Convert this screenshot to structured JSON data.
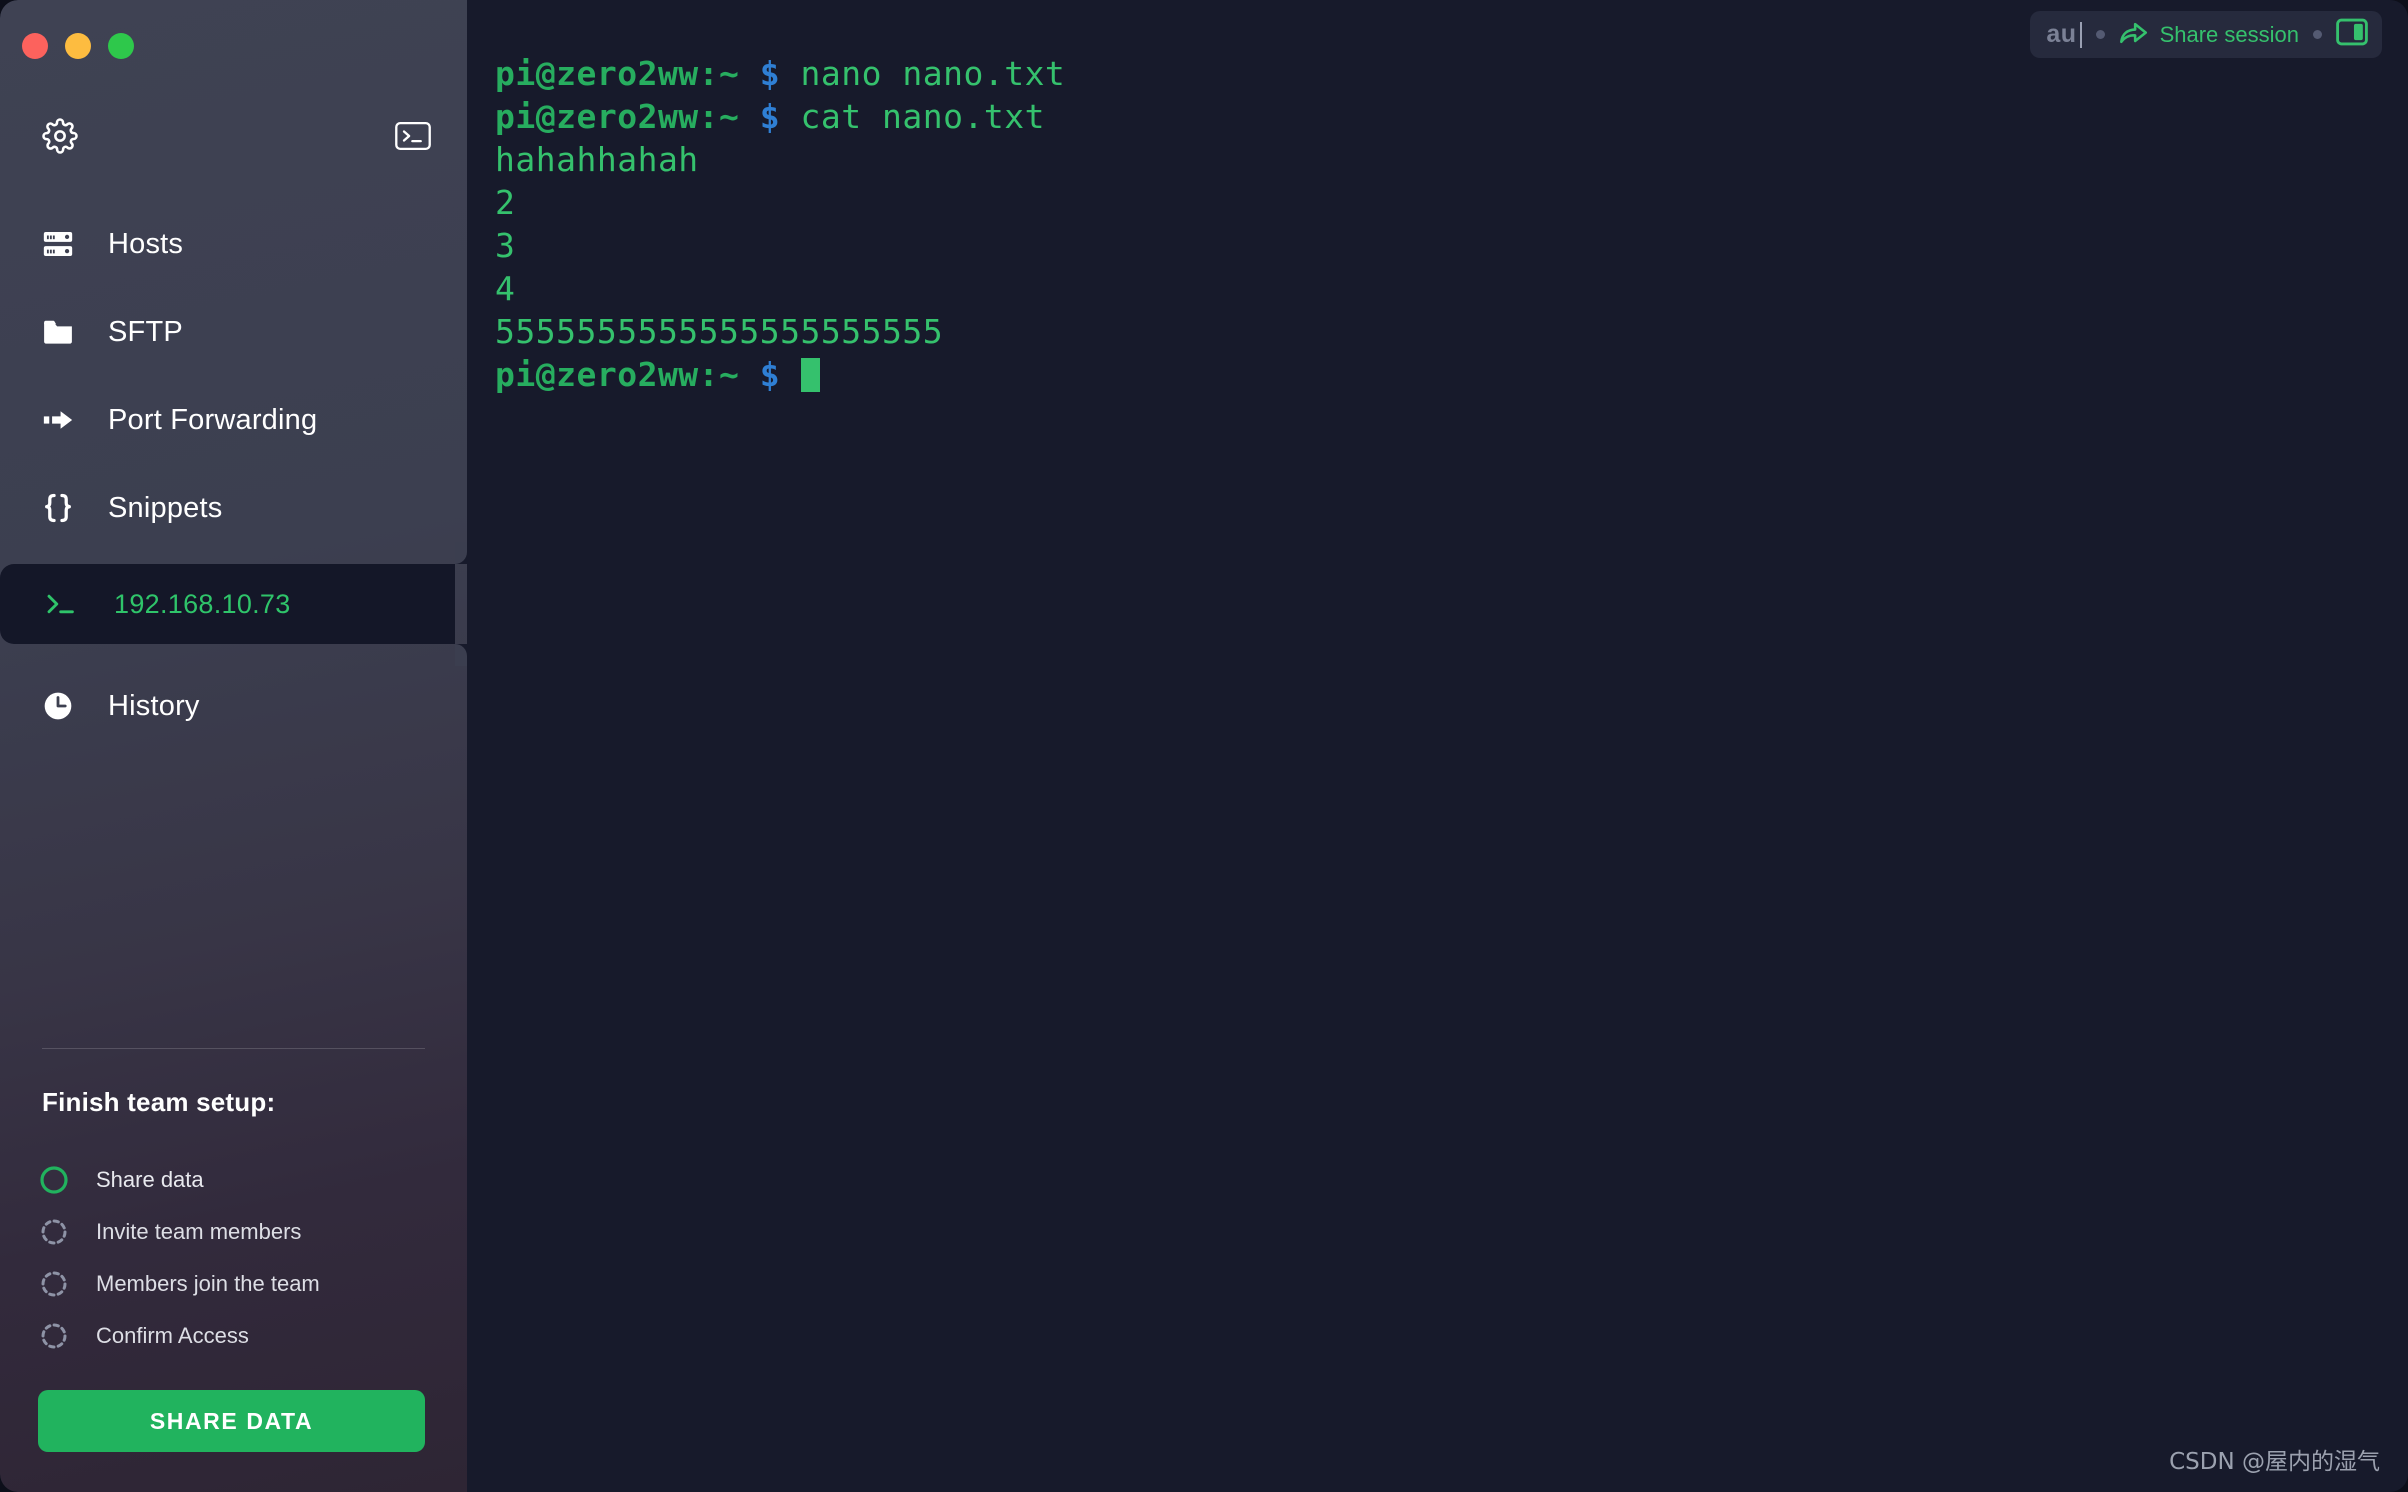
{
  "window": {
    "traffic_lights": [
      {
        "name": "close",
        "color": "#fc625d"
      },
      {
        "name": "minimize",
        "color": "#fdbc40"
      },
      {
        "name": "maximize",
        "color": "#2ec84b"
      }
    ]
  },
  "sidebar": {
    "toolbar": {
      "settings_icon": "gear-icon",
      "new_terminal_icon": "terminal-icon"
    },
    "items": [
      {
        "label": "Hosts",
        "icon": "server-rack-icon"
      },
      {
        "label": "SFTP",
        "icon": "folder-icon"
      },
      {
        "label": "Port Forwarding",
        "icon": "arrow-forward-icon"
      },
      {
        "label": "Snippets",
        "icon": "curly-braces-icon"
      }
    ],
    "active_session": {
      "label": "192.168.10.73",
      "icon": "terminal-prompt-icon",
      "color": "#2fc46a"
    },
    "history": {
      "label": "History",
      "icon": "clock-icon"
    }
  },
  "team_setup": {
    "title": "Finish team setup:",
    "steps": [
      {
        "label": "Share data",
        "state": "active"
      },
      {
        "label": "Invite team members",
        "state": "pending"
      },
      {
        "label": "Members join the team",
        "state": "pending"
      },
      {
        "label": "Confirm Access",
        "state": "pending"
      }
    ],
    "button_label": "SHARE DATA",
    "button_color": "#21b35e"
  },
  "session_bar": {
    "autocomplete_value": "au",
    "share_label": "Share session",
    "share_icon": "share-arrow-icon",
    "split_icon": "split-pane-icon",
    "accent_color": "#35c16d"
  },
  "terminal": {
    "prompt": "pi@zero2ww:~",
    "dollar": "$",
    "lines": [
      {
        "type": "command",
        "prompt": "pi@zero2ww:~",
        "dollar": "$",
        "command": "nano nano.txt"
      },
      {
        "type": "command",
        "prompt": "pi@zero2ww:~",
        "dollar": "$",
        "command": "cat nano.txt"
      },
      {
        "type": "output",
        "text": "hahahhahah"
      },
      {
        "type": "output",
        "text": "2"
      },
      {
        "type": "output",
        "text": "3"
      },
      {
        "type": "output",
        "text": "4"
      },
      {
        "type": "output",
        "text": "5555555555555555555555"
      },
      {
        "type": "prompt",
        "prompt": "pi@zero2ww:~",
        "dollar": "$",
        "command": ""
      }
    ],
    "background_color": "#171a2b",
    "prompt_color": "#27ad5f",
    "dollar_color": "#2f7fd4",
    "text_color": "#35c16d"
  },
  "watermark": {
    "text": "CSDN @屋内的湿气"
  }
}
